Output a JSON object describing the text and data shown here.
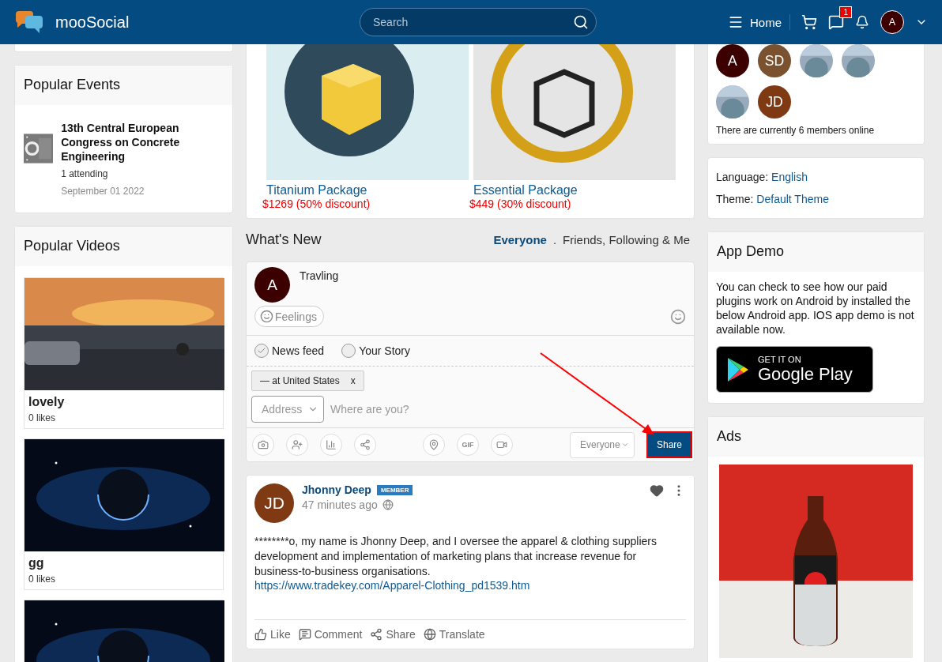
{
  "header": {
    "logo_text": "mooSocial",
    "search": {
      "placeholder": "Search"
    },
    "home": "Home",
    "messages_badge": "1",
    "avatar": {
      "initials": "A",
      "color": "#3d0000"
    }
  },
  "left": {
    "events_title": "Popular Events",
    "events": [
      {
        "title": "13th Central European Congress on Concrete Engineering",
        "attending": "1 attending",
        "date": "September 01 2022"
      }
    ],
    "videos_title": "Popular Videos",
    "videos": [
      {
        "kind": "sunset",
        "title": "lovely",
        "likes": "0 likes"
      },
      {
        "kind": "space",
        "title": "gg",
        "likes": "0 likes"
      },
      {
        "kind": "space"
      }
    ]
  },
  "middle": {
    "packages": [
      {
        "kind": "yellow-box",
        "name": "Titanium Package",
        "price": "$1269 (50% discount)"
      },
      {
        "kind": "outline-box",
        "name": "Essential Package",
        "price": "$449 (30% discount)"
      }
    ],
    "whats_new": {
      "title": "What's New",
      "separator": ".",
      "filters": [
        {
          "label": "Everyone",
          "selected": true
        },
        {
          "label": "Friends, Following & Me",
          "selected": false
        }
      ]
    },
    "composer": {
      "avatar": {
        "initials": "A",
        "color": "#3d0000"
      },
      "value": "Travling",
      "feelings": "Feelings",
      "destinations": [
        {
          "label": "News feed",
          "selected": true
        },
        {
          "label": "Your Story",
          "selected": false
        }
      ],
      "location_tag": "— at United States",
      "tag_remove": "x",
      "address": "Address",
      "location_placeholder": "Where are you?",
      "tools": [
        {
          "kind": "camera"
        },
        {
          "kind": "tag"
        },
        {
          "kind": "poll"
        },
        {
          "kind": "share"
        },
        {
          "kind": "location"
        },
        {
          "kind": "gif",
          "label": "GIF"
        },
        {
          "kind": "video"
        }
      ],
      "privacy": "Everyone",
      "share": "Share",
      "share_highlighted": true
    },
    "post": {
      "avatar": {
        "initials": "JD",
        "color": "#7f3a14"
      },
      "author": "Jhonny Deep",
      "badge": "MEMBER",
      "time": "47 minutes ago",
      "text": "********o, my name is Jhonny Deep, and I oversee the apparel & clothing suppliers development and implementation of marketing plans that increase revenue for business-to-business organisations.",
      "link": "https://www.tradekey.com/Apparel-Clothing_pd1539.htm",
      "actions": [
        {
          "kind": "like",
          "label": "Like"
        },
        {
          "kind": "comment",
          "label": "Comment"
        },
        {
          "kind": "share",
          "label": "Share"
        },
        {
          "kind": "translate",
          "label": "Translate"
        }
      ]
    }
  },
  "right": {
    "members": [
      {
        "kind": "initials",
        "initials": "A",
        "color": "#3d0000"
      },
      {
        "kind": "initials",
        "initials": "SD",
        "color": "#7a5230"
      },
      {
        "kind": "picture"
      },
      {
        "kind": "picture"
      },
      {
        "kind": "picture"
      },
      {
        "kind": "initials",
        "initials": "JD",
        "color": "#7f3a14"
      }
    ],
    "online_text": "There are currently 6 members online",
    "settings": [
      {
        "label": "Language:",
        "value": "English"
      },
      {
        "label": "Theme:",
        "value": "Default Theme"
      }
    ],
    "app_demo": {
      "title": "App Demo",
      "text": "You can check to see how our paid plugins work on Android by installed the below Android app. IOS app demo is not available now.",
      "badge_small": "GET IT ON",
      "badge_large": "Google Play"
    },
    "ads_title": "Ads"
  }
}
